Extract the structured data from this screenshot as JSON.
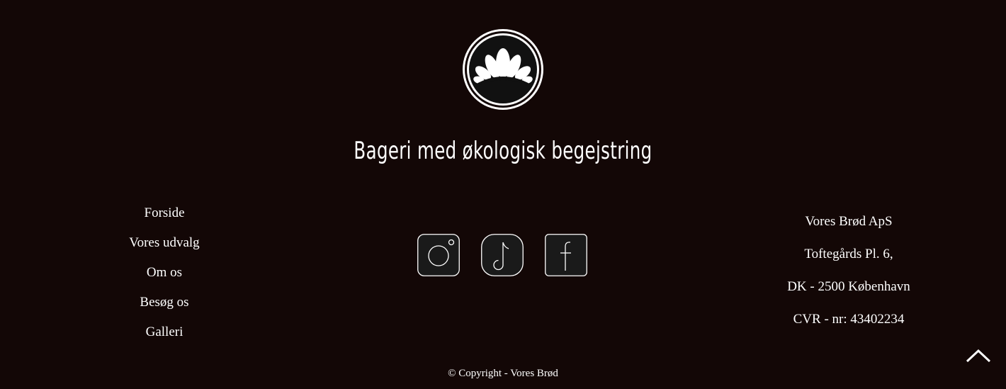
{
  "logo": {
    "icon": "croissant-icon",
    "alt": "Vores Brød logo"
  },
  "tagline": "Bageri med økologisk begejstring",
  "nav": {
    "items": [
      {
        "label": "Forside"
      },
      {
        "label": "Vores udvalg"
      },
      {
        "label": "Om os"
      },
      {
        "label": "Besøg os"
      },
      {
        "label": "Galleri"
      }
    ]
  },
  "social": {
    "items": [
      {
        "name": "Instagram",
        "icon": "instagram-icon"
      },
      {
        "name": "TikTok",
        "icon": "tiktok-icon"
      },
      {
        "name": "Facebook",
        "icon": "facebook-icon"
      }
    ]
  },
  "address": {
    "company": "Vores Brød ApS",
    "street": "Toftegårds Pl. 6,",
    "city": "DK - 2500 København",
    "cvr": "CVR - nr: 43402234"
  },
  "footer": {
    "copyright": "© Copyright - Vores Brød"
  },
  "scroll_top": {
    "icon": "chevron-up-icon"
  },
  "colors": {
    "background": "#130706",
    "text": "#ffffff",
    "icon_fill": "#1a1a1a"
  }
}
